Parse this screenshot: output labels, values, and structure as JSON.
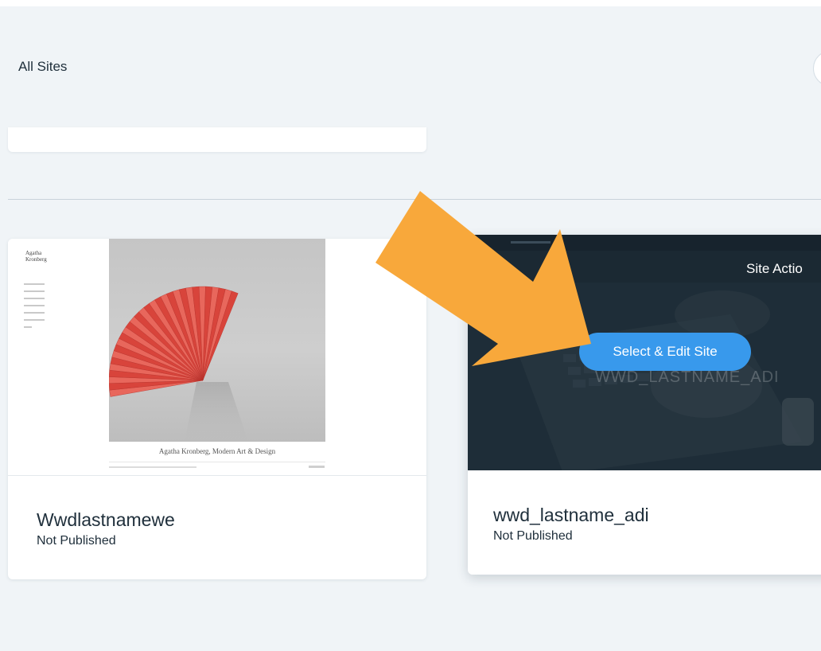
{
  "header": {
    "breadcrumb": "All Sites"
  },
  "sites": [
    {
      "name": "Wwdlastnamewe",
      "status": "Not Published",
      "thumbnail": {
        "logo_line1": "Agatha",
        "logo_line2": "Kronberg",
        "caption": "Agatha Kronberg, Modern Art & Design"
      }
    },
    {
      "name": "wwd_lastname_adi",
      "status": "Not Published",
      "thumbnail": {
        "overlay_name": "WWD_LASTNAME_ADI"
      },
      "hover": {
        "site_actions_label": "Site Actio",
        "edit_button_label": "Select & Edit Site"
      }
    }
  ],
  "colors": {
    "page_background": "#f0f4f7",
    "primary_button": "#3899ec",
    "annotation_arrow": "#f8a83b",
    "text_primary": "#20303c"
  },
  "icons": {
    "annotation": "arrow-pointing-icon"
  }
}
